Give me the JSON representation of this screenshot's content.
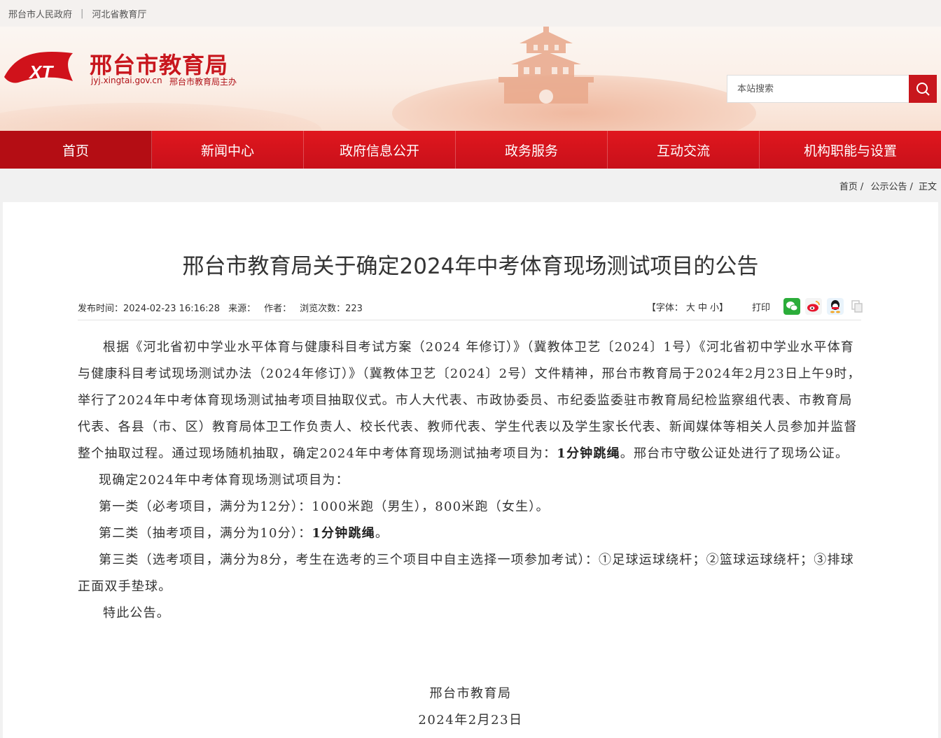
{
  "topbar": {
    "link1": "邢台市人民政府",
    "link2": "河北省教育厅"
  },
  "header": {
    "title": "邢台市教育局",
    "domain": "jyj.xingtai.gov.cn",
    "sponsor": "邢台市教育局主办",
    "logo_text": "XT"
  },
  "search": {
    "placeholder": "本站搜索"
  },
  "nav": [
    "首页",
    "新闻中心",
    "政府信息公开",
    "政务服务",
    "互动交流",
    "机构职能与设置"
  ],
  "breadcrumb": {
    "home": "首页",
    "sep": "/",
    "section": "公示公告",
    "current": "正文"
  },
  "article": {
    "title": "邢台市教育局关于确定2024年中考体育现场测试项目的公告",
    "meta": {
      "publish": "发布时间：2024-02-23 16:16:28",
      "source": "来源：",
      "author": "作者：",
      "views": "浏览次数：223"
    },
    "tools": {
      "font_label": "【字体：",
      "big": "大",
      "mid": "中",
      "small": "小",
      "font_end": "】",
      "print": "打印"
    },
    "para1_a": "根据《河北省初中学业水平体育与健康科目考试方案（2024 年修订）》（冀教体卫艺〔2024〕1号）《河北省初中学业水平体育与健康科目考试现场测试办法（2024年修订）》（冀教体卫艺〔2024〕2号）文件精神，邢台市教育局于2024年2月23日上午9时，举行了2024年中考体育现场测试抽考项目抽取仪式。市人大代表、市政协委员、市纪委监委驻市教育局纪检监察组代表、市教育局代表、各县（市、区）教育局体卫工作负责人、校长代表、教师代表、学生代表以及学生家长代表、新闻媒体等相关人员参加并监督整个抽取过程。通过现场随机抽取，确定2024年中考体育现场测试抽考项目为：",
    "para1_b": "1分钟跳绳",
    "para1_c": "。邢台市守敬公证处进行了现场公证。",
    "para2": "现确定2024年中考体育现场测试项目为：",
    "para3": "第一类（必考项目，满分为12分）：1000米跑（男生），800米跑（女生）。",
    "para4_a": "第二类（抽考项目，满分为10分）：",
    "para4_b": "1分钟跳绳",
    "para4_c": "。",
    "para5": "第三类（选考项目，满分为8分，考生在选考的三个项目中自主选择一项参加考试）：①足球运球绕杆；②篮球运球绕杆；③排球正面双手垫球。",
    "para6": "特此公告。",
    "sign_org": "邢台市教育局",
    "sign_date": "2024年2月23日"
  },
  "colors": {
    "brand_red": "#c8161d",
    "nav_red": "#d8141c"
  }
}
